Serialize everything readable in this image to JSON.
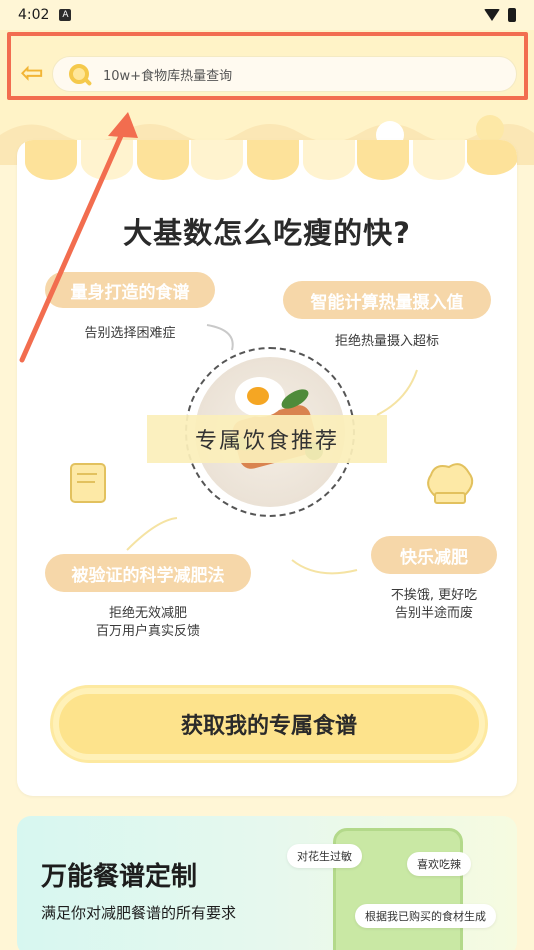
{
  "status_bar": {
    "time": "4:02",
    "sim_label": "A"
  },
  "header": {
    "search_placeholder": "10w+食物库热量查询"
  },
  "card": {
    "title": "大基数怎么吃瘦的快?",
    "feature_1": {
      "label": "量身打造的食谱",
      "sub": "告别选择困难症"
    },
    "feature_2": {
      "label": "智能计算热量摄入值",
      "sub": "拒绝热量摄入超标"
    },
    "feature_3": {
      "label": "被验证的科学减肥法",
      "sub_line1": "拒绝无效减肥",
      "sub_line2": "百万用户真实反馈"
    },
    "feature_4": {
      "label": "快乐减肥",
      "sub_line1": "不挨饿, 更好吃",
      "sub_line2": "告别半途而废"
    },
    "center_label": "专属饮食推荐",
    "cta_label": "获取我的专属食谱"
  },
  "banner": {
    "title": "万能餐谱定制",
    "subtitle": "满足你对减肥餐谱的所有要求",
    "chip_1": "对花生过敏",
    "chip_2": "喜欢吃辣",
    "chip_3": "根据我已购买的食材生成"
  },
  "colors": {
    "accent": "#f2b536",
    "highlight": "#f26d4f",
    "pill": "#f6d7a9",
    "cta": "#fde38c"
  }
}
